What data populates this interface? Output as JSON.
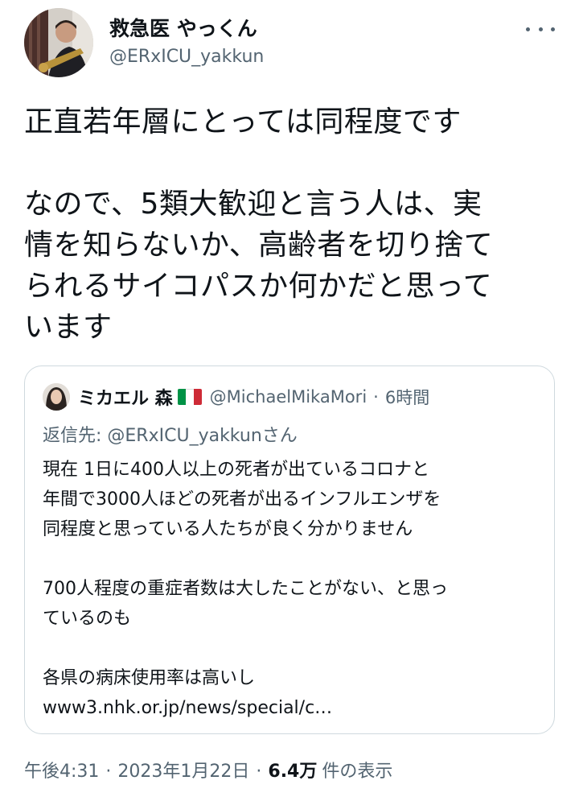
{
  "author": {
    "display_name": "救急医 やっくん",
    "handle": "@ERxICU_yakkun"
  },
  "tweet": {
    "lines": [
      "正直若年層にとっては同程度です",
      "",
      "なので、5類大歓迎と言う人は、実",
      "情を知らないか、高齢者を切り捨て",
      "られるサイコパスか何かだと思って",
      "います"
    ]
  },
  "quote": {
    "display_name": "ミカエル 森",
    "handle": "@MichaelMikaMori",
    "separator": "·",
    "time": "6時間",
    "reply_label": "返信先: ",
    "reply_handle": "@ERxICU_yakkun",
    "reply_suffix": "さん",
    "lines": [
      "現在 1日に400人以上の死者が出ているコロナと",
      "年間で3000人ほどの死者が出るインフルエンザを",
      "同程度と思っている人たちが良く分かりません",
      "",
      "700人程度の重症者数は大したことがない、と思っ",
      "ているのも",
      "",
      "各県の病床使用率は高いし",
      "www3.nhk.or.jp/news/special/c…"
    ],
    "flag_colors": [
      "#009246",
      "#ffffff",
      "#ce2b37"
    ]
  },
  "footer": {
    "time": "午後4:31",
    "separator": "·",
    "date": "2023年1月22日",
    "views_count": "6.4万",
    "views_label": "件の表示"
  },
  "icons": {
    "more": "more-horizontal-icon",
    "flag": "italy-flag-icon"
  },
  "colors": {
    "text_primary": "#0f1419",
    "text_secondary": "#536471",
    "border": "#cfd9de"
  }
}
